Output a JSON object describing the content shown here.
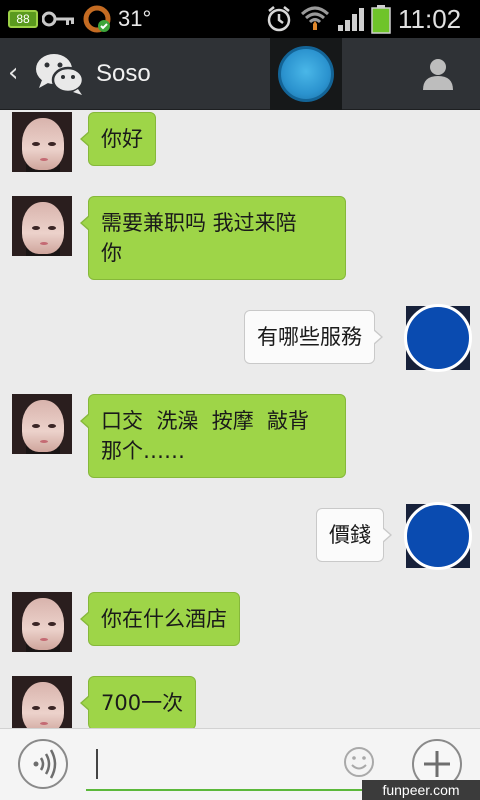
{
  "status_bar": {
    "battery_small": "88",
    "temperature": "31°",
    "time": "11:02",
    "icons": [
      "battery-icon",
      "key-icon",
      "ring-icon",
      "alarm-icon",
      "wifi-icon",
      "signal-icon",
      "battery-icon"
    ]
  },
  "header": {
    "title": "Soso",
    "icons": [
      "back-icon",
      "wechat-logo-icon",
      "floating-orb-icon",
      "profile-icon"
    ]
  },
  "messages": [
    {
      "side": "left",
      "text": "你好"
    },
    {
      "side": "left",
      "text": "需要兼职吗 我过来陪\n你"
    },
    {
      "side": "right",
      "text": "有哪些服務"
    },
    {
      "side": "left",
      "text": "口交  洗澡  按摩  敲背\n那个……"
    },
    {
      "side": "right",
      "text": "價錢"
    },
    {
      "side": "left",
      "text": "你在什么酒店"
    },
    {
      "side": "left",
      "text": "700一次"
    }
  ],
  "input_bar": {
    "icons": [
      "voice-icon",
      "emoji-icon",
      "plus-icon"
    ],
    "value": ""
  },
  "watermark": "funpeer.com",
  "colors": {
    "bubble_green": "#9ed548",
    "bubble_white": "#fbfbfb",
    "header_bg": "#2f3236",
    "avatar_blue": "#0a4bb0",
    "input_underline": "#5bb83a"
  }
}
